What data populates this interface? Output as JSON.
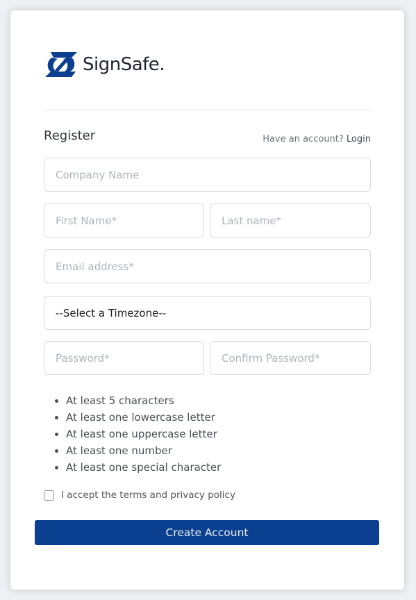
{
  "brand": {
    "name": "SignSafe.",
    "logo_icon": "signsafe-logo-icon",
    "color": "#0b3f8f"
  },
  "form": {
    "title": "Register",
    "have_account_text": "Have an account?",
    "login_link": "Login",
    "company_name_placeholder": "Company Name",
    "first_name_placeholder": "First Name*",
    "last_name_placeholder": "Last name*",
    "email_placeholder": "Email address*",
    "timezone_selected": "--Select a Timezone--",
    "password_placeholder": "Password*",
    "confirm_password_placeholder": "Confirm Password*",
    "password_rules": [
      "At least 5 characters",
      "At least one lowercase letter",
      "At least one uppercase letter",
      "At least one number",
      "At least one special character"
    ],
    "terms_label": "I accept the terms and privacy policy",
    "terms_checked": false,
    "submit_label": "Create Account",
    "submit_color": "#0b3f8f"
  }
}
